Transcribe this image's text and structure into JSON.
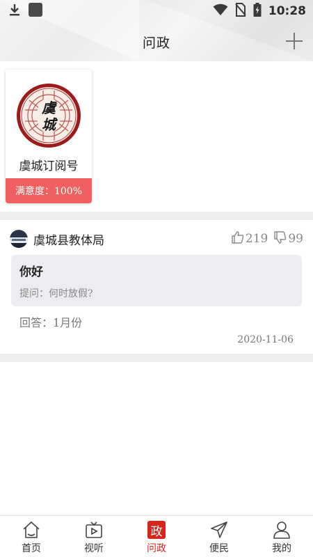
{
  "status_bar": {
    "time": "10:28",
    "icons": [
      "download-icon",
      "app-notification-icon",
      "wifi-icon",
      "no-sim-icon",
      "battery-charging-icon"
    ]
  },
  "header": {
    "title": "问政",
    "add_icon": "plus-icon"
  },
  "subscription": {
    "name": "虞城订阅号",
    "seal_text": "虞城",
    "satisfaction": "满意度：100%"
  },
  "question": {
    "org_name": "虞城县教体局",
    "likes": "219",
    "dislikes": "99",
    "title": "你好",
    "detail": "提问：何时放假?",
    "answer": "回答：1月份",
    "date": "2020-11-06"
  },
  "tabs": [
    {
      "label": "首页",
      "icon": "home-icon"
    },
    {
      "label": "视听",
      "icon": "tv-icon"
    },
    {
      "label": "问政",
      "icon": "zheng-icon",
      "glyph": "政"
    },
    {
      "label": "便民",
      "icon": "send-icon"
    },
    {
      "label": "我的",
      "icon": "user-icon"
    }
  ],
  "colors": {
    "accent_red": "#d6261e",
    "satisfaction_bar": "#f06060",
    "question_box": "#ebedf0"
  }
}
